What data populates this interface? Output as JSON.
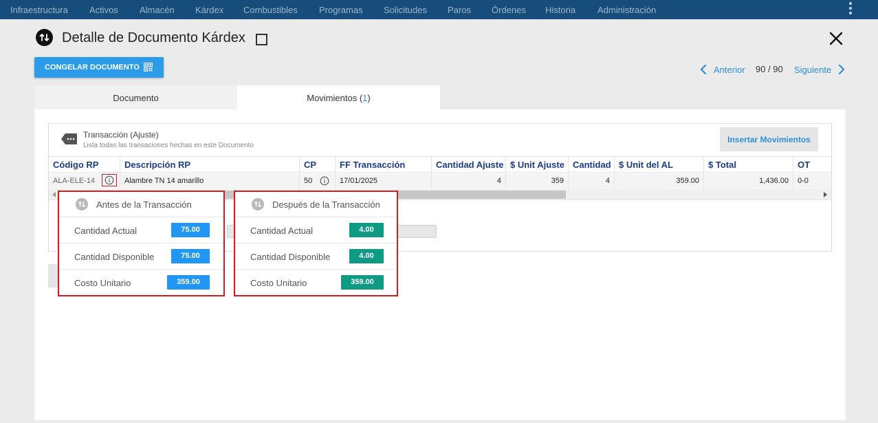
{
  "nav": {
    "items": [
      "Infraestructura",
      "Activos",
      "Almacén",
      "Kárdex",
      "Combustibles",
      "Programas",
      "Solicitudes",
      "Paros",
      "Órdenes",
      "Historia",
      "Administración"
    ]
  },
  "header": {
    "title": "Detalle de Documento Kárdex",
    "freeze_button": "CONGELAR DOCUMENTO"
  },
  "pager": {
    "prev_label": "Anterior",
    "count": "90 / 90",
    "next_label": "Siguiente"
  },
  "tabs": {
    "documento": "Documento",
    "movimientos": "Movimientos",
    "movimientos_count": "1"
  },
  "transaction": {
    "title": "Transacción (Ajuste)",
    "subtitle": "Lista todas las transaciones hechas en este Documento",
    "insert_button": "Insertar Movimientos"
  },
  "table": {
    "headers": [
      "Código RP",
      "Descripción RP",
      "CP",
      "FF Transacción",
      "Cantidad Ajuste",
      "$ Unit Ajuste",
      "Cantidad",
      "$ Unit del AL",
      "$ Total",
      "OT"
    ],
    "row": {
      "codigo": "ALA-ELE-14",
      "descripcion": "Alambre TN 14 amarillo",
      "cp": "50",
      "fecha": "17/01/2025",
      "cantidad_ajuste": "4",
      "unit_ajuste": "359",
      "cantidad": "4",
      "unit_al": "359.00",
      "total": "1,436.00",
      "ot": "0-0"
    }
  },
  "before": {
    "title": "Antes de la Transacción",
    "rows": [
      {
        "label": "Cantidad Actual",
        "value": "75.00"
      },
      {
        "label": "Cantidad Disponible",
        "value": "75.00"
      },
      {
        "label": "Costo Unitario",
        "value": "359.00"
      }
    ],
    "color": "#2196f3"
  },
  "after": {
    "title": "Después de la Transacción",
    "rows": [
      {
        "label": "Cantidad Actual",
        "value": "4.00"
      },
      {
        "label": "Cantidad Disponible",
        "value": "4.00"
      },
      {
        "label": "Costo Unitario",
        "value": "359.00"
      }
    ],
    "color": "#0f9a84"
  },
  "icons": {
    "title": "swap-vertical-icon",
    "close": "close-icon",
    "freeze": "qr-code-icon",
    "prev": "chevron-left-icon",
    "next": "chevron-right-icon",
    "transaction": "tag-icon",
    "info": "info-icon",
    "popup": "swap-vertical-icon"
  },
  "colors": {
    "nav_bg": "#164d7a",
    "accent": "#2b8fd6",
    "header_text": "#1a3a8a",
    "highlight": "#d41c1c"
  }
}
